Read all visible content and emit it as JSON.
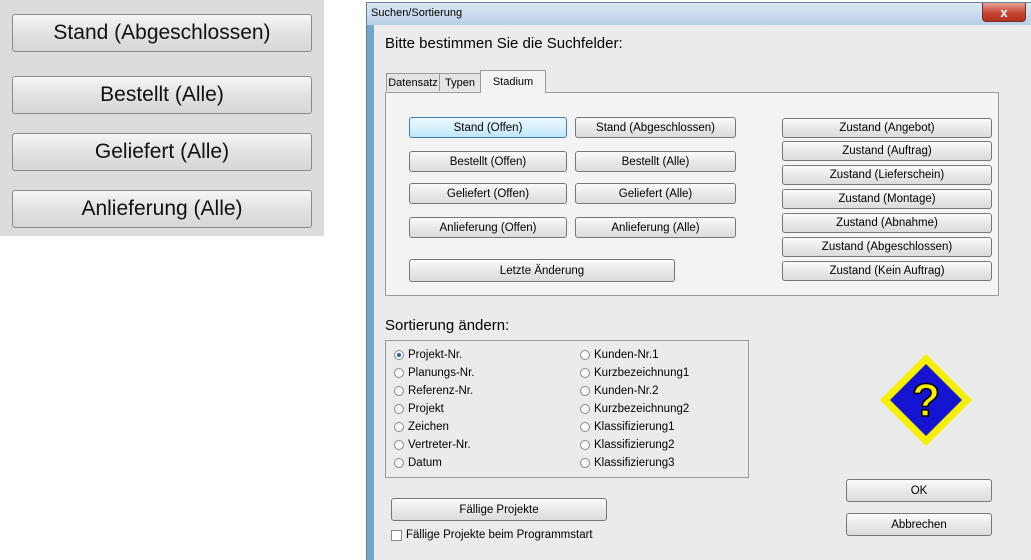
{
  "zoom_panel": {
    "buttons": [
      "Stand (Abgeschlossen)",
      "Bestellt (Alle)",
      "Geliefert (Alle)",
      "Anlieferung (Alle)"
    ]
  },
  "dialog": {
    "title": "Suchen/Sortierung",
    "close_glyph": "x",
    "heading": "Bitte bestimmen Sie die Suchfelder:",
    "tabs": [
      "Datensatz",
      "Typen",
      "Stadium"
    ],
    "stadium": {
      "left_buttons": [
        "Stand (Offen)",
        "Bestellt (Offen)",
        "Geliefert (Offen)",
        "Anlieferung (Offen)"
      ],
      "mid_buttons": [
        "Stand (Abgeschlossen)",
        "Bestellt (Alle)",
        "Geliefert (Alle)",
        "Anlieferung (Alle)"
      ],
      "last_change": "Letzte Änderung",
      "zustand_buttons": [
        "Zustand (Angebot)",
        "Zustand (Auftrag)",
        "Zustand (Lieferschein)",
        "Zustand (Montage)",
        "Zustand (Abnahme)",
        "Zustand (Abgeschlossen)",
        "Zustand (Kein Auftrag)"
      ]
    },
    "sort_heading": "Sortierung ändern:",
    "sort_left": [
      "Projekt-Nr.",
      "Planungs-Nr.",
      "Referenz-Nr.",
      "Projekt",
      "Zeichen",
      "Vertreter-Nr.",
      "Datum"
    ],
    "sort_right": [
      "Kunden-Nr.1",
      "Kurzbezeichnung1",
      "Kunden-Nr.2",
      "Kurzbezeichnung2",
      "Klassifizierung1",
      "Klassifizierung2",
      "Klassifizierung3"
    ],
    "due_button": "Fällige Projekte",
    "due_checkbox": "Fällige Projekte beim Programmstart",
    "ok": "OK",
    "cancel": "Abbrechen",
    "help_glyph": "?"
  },
  "colors": {
    "help_fill": "#1414d2",
    "help_border": "#f5f000",
    "focus_border": "#3c7fb1"
  }
}
